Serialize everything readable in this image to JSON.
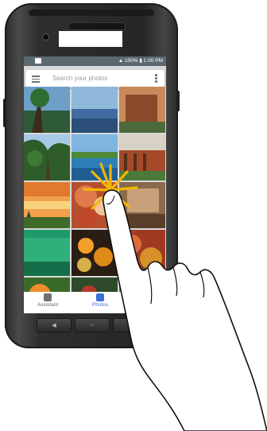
{
  "status_bar": {
    "battery": "100%",
    "time": "1:00",
    "time_suffix": "PM"
  },
  "search": {
    "placeholder": "Search your photos"
  },
  "photos": [
    {
      "id": "photo-1"
    },
    {
      "id": "photo-2"
    },
    {
      "id": "photo-3"
    },
    {
      "id": "photo-4"
    },
    {
      "id": "photo-5"
    },
    {
      "id": "photo-6"
    },
    {
      "id": "photo-7"
    },
    {
      "id": "photo-8"
    },
    {
      "id": "photo-9"
    },
    {
      "id": "photo-10"
    },
    {
      "id": "photo-11"
    },
    {
      "id": "photo-12"
    },
    {
      "id": "photo-13"
    },
    {
      "id": "photo-14"
    },
    {
      "id": "photo-15"
    }
  ],
  "bottom_nav": {
    "assistant_label": "Assistant",
    "photos_label": "Photos"
  },
  "colors": {
    "status_bar": "#5b6a70",
    "active_tab": "#3d6fd6",
    "tap_burst": "#f2b705"
  },
  "icons": {
    "menu": "menu-icon",
    "overflow": "overflow-menu-icon",
    "assistant": "assistant-icon",
    "photos": "photos-icon",
    "back": "back-key-icon",
    "home": "home-key-icon"
  }
}
